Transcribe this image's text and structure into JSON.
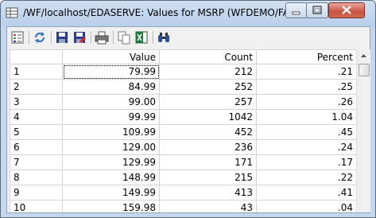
{
  "window": {
    "title": "/WF/localhost/EDASERVE: Values for MSRP (WFDEMO/FACT..."
  },
  "toolbar": {
    "buttons": [
      "properties-icon",
      "refresh-icon",
      "save-icon",
      "save-as-icon",
      "print-icon",
      "copy-icon",
      "export-excel-icon",
      "find-icon"
    ]
  },
  "grid": {
    "columns": [
      "",
      "Value",
      "Count",
      "Percent"
    ],
    "rows": [
      {
        "n": "1",
        "value": "79.99",
        "count": "212",
        "percent": ".21"
      },
      {
        "n": "2",
        "value": "84.99",
        "count": "252",
        "percent": ".25"
      },
      {
        "n": "3",
        "value": "99.00",
        "count": "257",
        "percent": ".26"
      },
      {
        "n": "4",
        "value": "99.99",
        "count": "1042",
        "percent": "1.04"
      },
      {
        "n": "5",
        "value": "109.99",
        "count": "452",
        "percent": ".45"
      },
      {
        "n": "6",
        "value": "129.00",
        "count": "236",
        "percent": ".24"
      },
      {
        "n": "7",
        "value": "129.99",
        "count": "171",
        "percent": ".17"
      },
      {
        "n": "8",
        "value": "148.99",
        "count": "215",
        "percent": ".22"
      },
      {
        "n": "9",
        "value": "149.99",
        "count": "413",
        "percent": ".41"
      },
      {
        "n": "10",
        "value": "159.98",
        "count": "43",
        "percent": ".04"
      }
    ]
  }
}
